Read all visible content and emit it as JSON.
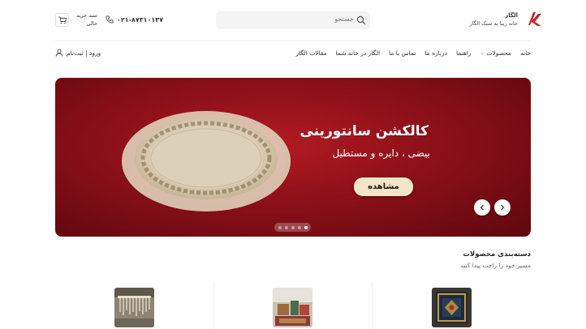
{
  "header": {
    "brand_name": "الگار",
    "brand_tagline": "خانه زیبا به سبک الگار",
    "search_placeholder": "جستجو",
    "phone": "۰۲۱-۸۷۳۱۰۱۳۷",
    "cart_title": "سبد خرید",
    "cart_status": "خالی"
  },
  "nav": {
    "items": [
      "خانه",
      "محصولات",
      "راهنما",
      "درباره ما",
      "تماس با ما",
      "الگار در خانه شما",
      "مقالات الگار"
    ],
    "login": "ورود | ثبت‌نام"
  },
  "hero": {
    "title": "کالکشن سانتورینی",
    "subtitle": "بیضی ، دایره و مستطیل",
    "cta": "مشاهده",
    "slide_count": 5,
    "active_slide": 5
  },
  "categories": {
    "title": "دسته‌بندی محصولات",
    "subtitle": "مسیر خود را راحت پیدا کنید"
  },
  "colors": {
    "hero_bg": "#8c1019",
    "cta_bg": "#f3e6c8",
    "logo": "#c2272d"
  },
  "icons": [
    "logo-mark",
    "search-icon",
    "phone-icon",
    "cart-icon",
    "chevron-down-icon",
    "user-icon",
    "arrow-left-icon",
    "arrow-right-icon"
  ]
}
